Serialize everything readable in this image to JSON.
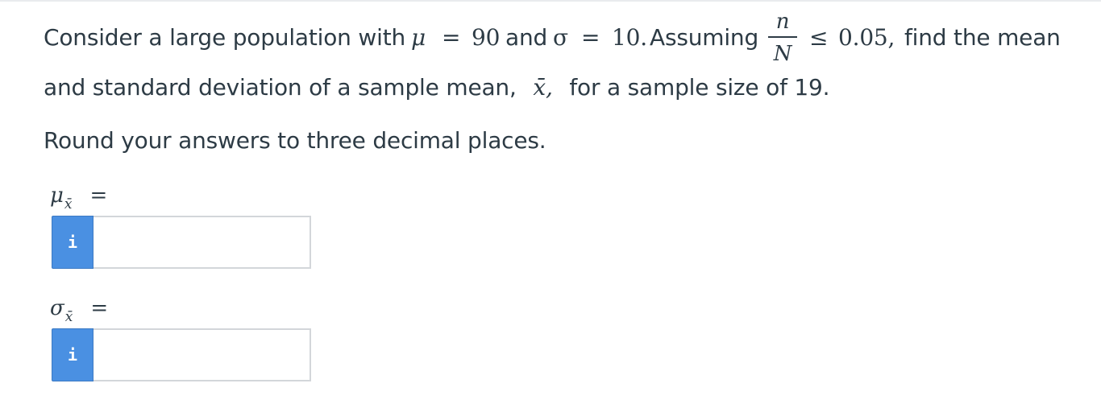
{
  "question": {
    "line1": {
      "prefix": "Consider a large population with",
      "mu_symbol": "μ",
      "eq1": "=",
      "mu_value": "90",
      "and_text": "and",
      "sigma_symbol": "σ",
      "eq2": "=",
      "sigma_value": "10.",
      "assuming_text": "Assuming",
      "frac_num": "n",
      "frac_den": "N",
      "leq": "≤",
      "ratio_value": "0.05,",
      "suffix": "find the mean"
    },
    "line2": {
      "prefix": "and standard deviation of a sample mean,",
      "xbar_symbol": "x̄,",
      "suffix": "for a sample size of 19."
    },
    "instruction": "Round your answers to three decimal places."
  },
  "answers": [
    {
      "symbol": "μ",
      "subscript": "x̄",
      "equals": "=",
      "info_glyph": "i",
      "value": "",
      "placeholder": ""
    },
    {
      "symbol": "σ",
      "subscript": "x̄",
      "equals": "=",
      "info_glyph": "i",
      "value": "",
      "placeholder": ""
    }
  ],
  "colors": {
    "info_button": "#4a90e2",
    "text": "#2d3b45",
    "input_border": "#d3d6da"
  }
}
